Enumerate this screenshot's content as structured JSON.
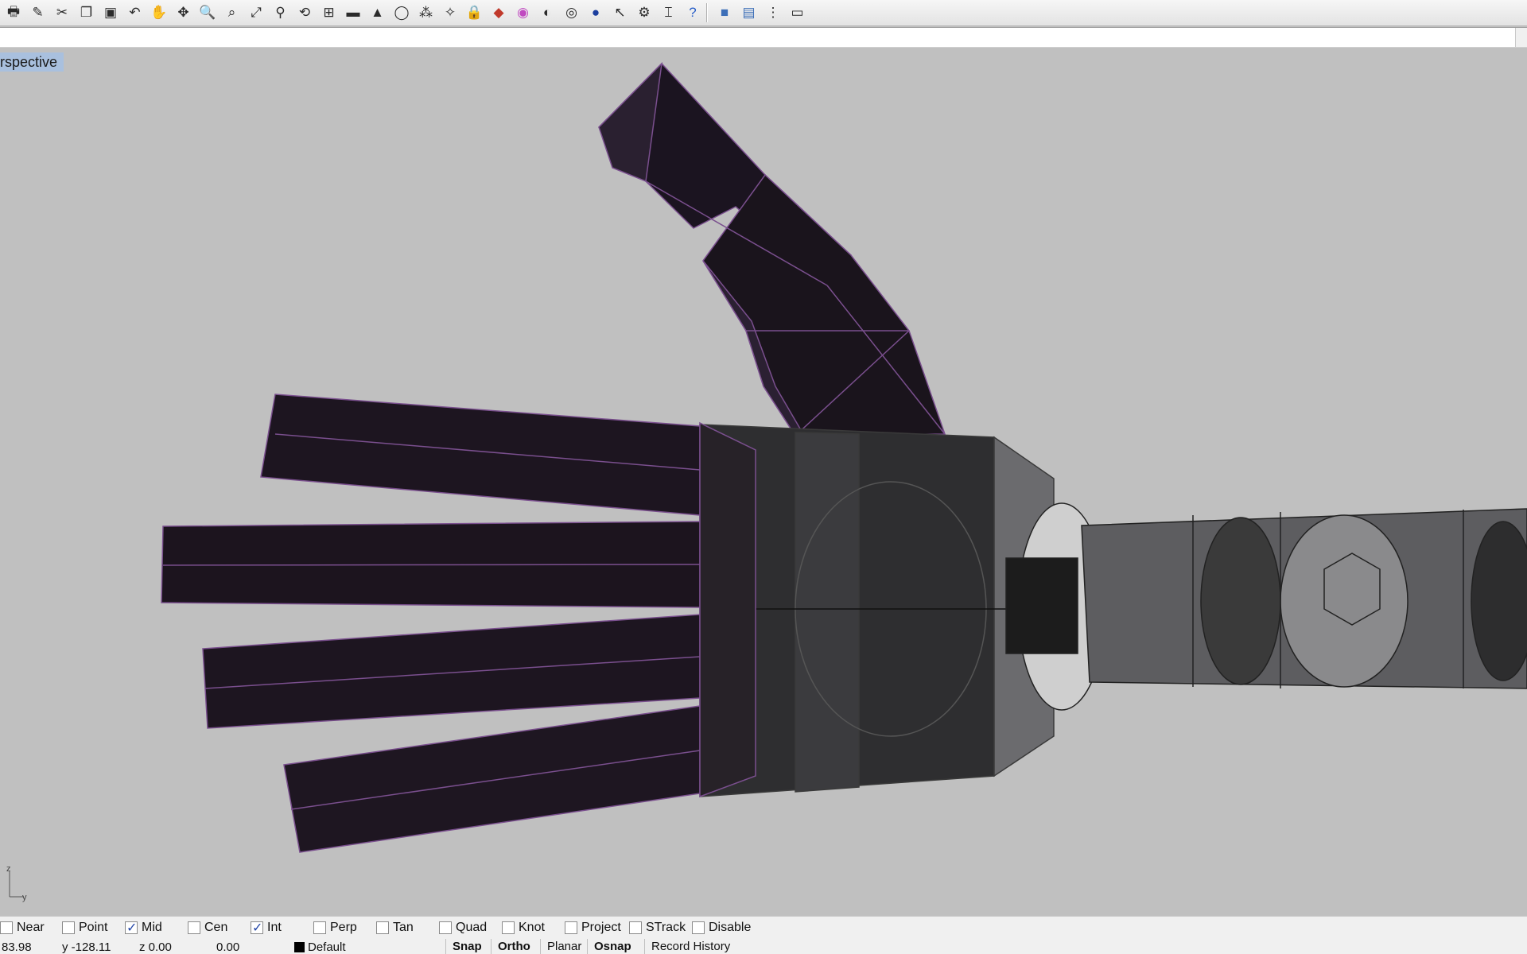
{
  "toolbar": {
    "icons": [
      "print-icon",
      "new-icon",
      "cut-icon",
      "copy-icon",
      "paste-icon",
      "undo-icon",
      "pan-icon",
      "rotate-view-icon",
      "zoom-icon",
      "zoom-window-icon",
      "zoom-extents-icon",
      "zoom-selected-icon",
      "undo-view-icon",
      "four-views-icon",
      "car-icon",
      "render-icon",
      "circle-icon",
      "snap-points-icon",
      "light-icon",
      "lock-icon",
      "layer-icon",
      "color-wheel-icon",
      "sphere-icon",
      "shade-icon",
      "sphere-blue-icon",
      "select-icon",
      "gear-icon",
      "dimension-icon",
      "help-icon",
      "solid-box-icon",
      "box-view-icon",
      "vertical-dots-icon",
      "viewport-icon"
    ]
  },
  "command": {
    "value": ""
  },
  "viewport": {
    "title": "rspective"
  },
  "axes": {
    "z": "z",
    "y": "y"
  },
  "osnap": [
    {
      "label": "Near",
      "checked": false
    },
    {
      "label": "Point",
      "checked": false
    },
    {
      "label": "Mid",
      "checked": true
    },
    {
      "label": "Cen",
      "checked": false
    },
    {
      "label": "Int",
      "checked": true
    },
    {
      "label": "Perp",
      "checked": false
    },
    {
      "label": "Tan",
      "checked": false
    },
    {
      "label": "Quad",
      "checked": false
    },
    {
      "label": "Knot",
      "checked": false
    },
    {
      "label": "Project",
      "checked": false
    },
    {
      "label": "STrack",
      "checked": false
    },
    {
      "label": "Disable",
      "checked": false
    }
  ],
  "status": {
    "x": "83.98",
    "y": "y -128.11",
    "z": "z 0.00",
    "w": "0.00",
    "layer": "Default",
    "snap": "Snap",
    "ortho": "Ortho",
    "planar": "Planar",
    "osnap": "Osnap",
    "record": "Record History"
  }
}
